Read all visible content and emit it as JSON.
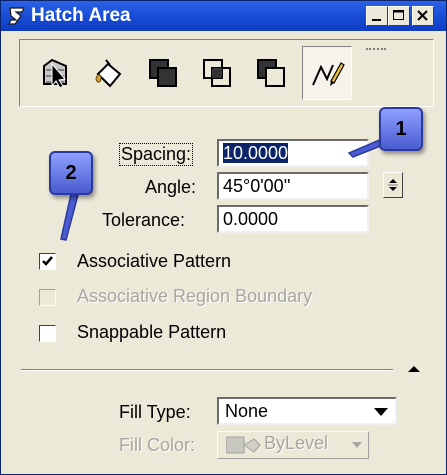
{
  "window": {
    "title": "Hatch Area",
    "controls": [
      "minimize",
      "maximize",
      "close"
    ]
  },
  "toolbar": {
    "tools": [
      {
        "icon": "element-select-icon"
      },
      {
        "icon": "flood-fill-icon"
      },
      {
        "icon": "union-icon"
      },
      {
        "icon": "intersection-icon"
      },
      {
        "icon": "difference-icon"
      },
      {
        "icon": "points-icon",
        "active": true
      }
    ]
  },
  "form": {
    "spacing": {
      "label": "Spacing:",
      "value": "10.0000"
    },
    "angle": {
      "label": "Angle:",
      "value": "45°0'00''"
    },
    "tolerance": {
      "label": "Tolerance:",
      "value": "0.0000"
    },
    "associative_pattern": {
      "label": "Associative Pattern",
      "checked": true,
      "enabled": true
    },
    "associative_region": {
      "label": "Associative Region Boundary",
      "checked": false,
      "enabled": false
    },
    "snappable_pattern": {
      "label": "Snappable Pattern",
      "checked": false,
      "enabled": true
    },
    "fill_type": {
      "label": "Fill Type:",
      "value": "None"
    },
    "fill_color": {
      "label": "Fill Color:",
      "value": "ByLevel",
      "enabled": false
    }
  },
  "callouts": [
    {
      "number": "1"
    },
    {
      "number": "2"
    }
  ],
  "colors": {
    "title_bar": "#1a4fd8",
    "selection": "#0a246a",
    "callout": "#6b7de8"
  }
}
